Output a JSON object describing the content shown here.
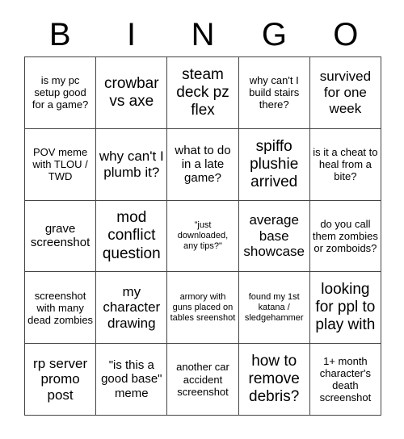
{
  "card": {
    "title": "BINGO",
    "header_letters": [
      "B",
      "I",
      "N",
      "G",
      "O"
    ],
    "grid_size": "5x5",
    "colors": {
      "background": "#ffffff",
      "text": "#000000",
      "border": "#444444"
    },
    "rows": [
      [
        {
          "text": "is my pc setup good for a game?",
          "size": "fs-sm"
        },
        {
          "text": "crowbar vs axe",
          "size": "fs-xl"
        },
        {
          "text": "steam deck pz flex",
          "size": "fs-xl"
        },
        {
          "text": "why can't I build stairs there?",
          "size": "fs-sm"
        },
        {
          "text": "survived for one week",
          "size": "fs-lg"
        }
      ],
      [
        {
          "text": "POV meme with TLOU / TWD",
          "size": "fs-sm"
        },
        {
          "text": "why can't I plumb it?",
          "size": "fs-lg"
        },
        {
          "text": "what to do in a late game?",
          "size": "fs-md"
        },
        {
          "text": "spiffo plushie arrived",
          "size": "fs-xl"
        },
        {
          "text": "is it a cheat to heal from a bite?",
          "size": "fs-sm"
        }
      ],
      [
        {
          "text": "grave screenshot",
          "size": "fs-md"
        },
        {
          "text": "mod conflict question",
          "size": "fs-xl"
        },
        {
          "text": "\"just downloaded, any tips?\"",
          "size": "fs-xs"
        },
        {
          "text": "average base showcase",
          "size": "fs-lg"
        },
        {
          "text": "do you call them zombies or zomboids?",
          "size": "fs-sm"
        }
      ],
      [
        {
          "text": "screenshot with many dead zombies",
          "size": "fs-sm"
        },
        {
          "text": "my character drawing",
          "size": "fs-lg"
        },
        {
          "text": "armory with guns placed on tables sreenshot",
          "size": "fs-xs"
        },
        {
          "text": "found my 1st katana / sledgehammer",
          "size": "fs-xs"
        },
        {
          "text": "looking for ppl to play with",
          "size": "fs-xl"
        }
      ],
      [
        {
          "text": "rp server promo post",
          "size": "fs-lg"
        },
        {
          "text": "\"is this a good base\" meme",
          "size": "fs-md"
        },
        {
          "text": "another car accident screenshot",
          "size": "fs-sm"
        },
        {
          "text": "how to remove debris?",
          "size": "fs-xl"
        },
        {
          "text": "1+ month character's death screenshot",
          "size": "fs-sm"
        }
      ]
    ]
  }
}
